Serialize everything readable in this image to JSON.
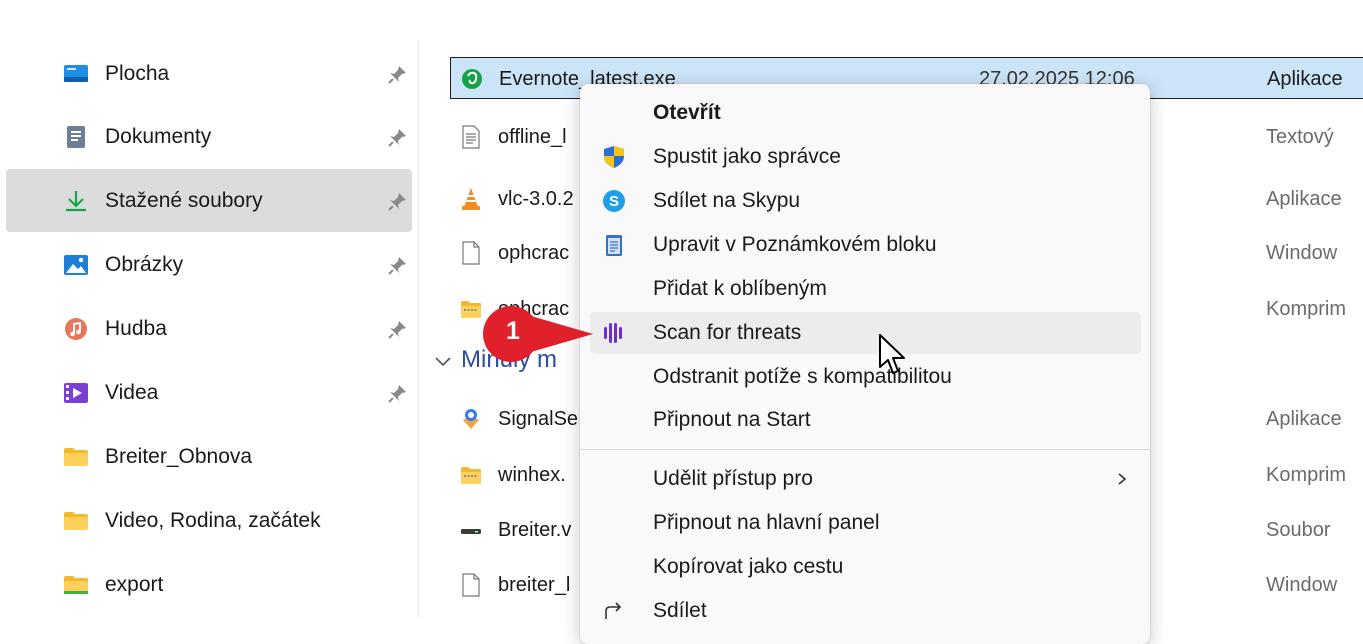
{
  "sidebar": {
    "items": [
      {
        "label": "Plocha",
        "icon": "desktop-icon",
        "pinned": true
      },
      {
        "label": "Dokumenty",
        "icon": "documents-icon",
        "pinned": true
      },
      {
        "label": "Stažené soubory",
        "icon": "download-icon",
        "pinned": true,
        "selected": true
      },
      {
        "label": "Obrázky",
        "icon": "pictures-icon",
        "pinned": true
      },
      {
        "label": "Hudba",
        "icon": "music-icon",
        "pinned": true
      },
      {
        "label": "Videa",
        "icon": "videos-icon",
        "pinned": true
      },
      {
        "label": "Breiter_Obnova",
        "icon": "folder-icon",
        "pinned": false
      },
      {
        "label": "Video, Rodina, začátek",
        "icon": "folder-icon",
        "pinned": false
      },
      {
        "label": "export",
        "icon": "folder-icon",
        "pinned": false
      }
    ]
  },
  "files": {
    "rows": [
      {
        "name": "Evernote_latest.exe",
        "date": "27.02.2025 12:06",
        "type": "Aplikace",
        "icon": "evernote-icon",
        "selected": true
      },
      {
        "name": "offline_l",
        "date": "",
        "type": "Textový",
        "icon": "text-file-icon"
      },
      {
        "name": "vlc-3.0.2",
        "date": "",
        "type": "Aplikace",
        "icon": "vlc-icon"
      },
      {
        "name": "ophcrac",
        "date": "",
        "type": "Window",
        "icon": "blank-file-icon"
      },
      {
        "name": "ophcrac",
        "date": "",
        "type": "Komprim",
        "icon": "zip-folder-icon"
      },
      {
        "name": "SignalSe",
        "date": "",
        "type": "Aplikace",
        "icon": "signal-setup-icon"
      },
      {
        "name": "winhex.",
        "date": "",
        "type": "Komprim",
        "icon": "zip-folder-icon"
      },
      {
        "name": "Breiter.v",
        "date": "",
        "type": "Soubor",
        "icon": "drive-file-icon"
      },
      {
        "name": "breiter_l",
        "date": "",
        "type": "Window",
        "icon": "blank-file-icon"
      }
    ],
    "group_header": "Minulý m"
  },
  "context_menu": {
    "items": [
      {
        "label": "Otevřít",
        "icon": "",
        "bold": true
      },
      {
        "label": "Spustit jako správce",
        "icon": "uac-shield-icon"
      },
      {
        "label": "Sdílet na Skypu",
        "icon": "skype-icon"
      },
      {
        "label": "Upravit v Poznámkovém bloku",
        "icon": "notepad-icon"
      },
      {
        "label": "Přidat k oblíbeným",
        "icon": ""
      },
      {
        "label": "Scan for threats",
        "icon": "scan-threats-icon",
        "hover": true
      },
      {
        "label": "Odstranit potíže s kompatibilitou",
        "icon": ""
      },
      {
        "label": "Připnout na Start",
        "icon": ""
      },
      {
        "label": "Udělit přístup pro",
        "icon": "",
        "submenu": true
      },
      {
        "label": "Připnout na hlavní panel",
        "icon": ""
      },
      {
        "label": "Kopírovat jako cestu",
        "icon": ""
      },
      {
        "label": "Sdílet",
        "icon": "share-icon"
      }
    ]
  },
  "annotation": {
    "step": "1",
    "color": "#e0202a"
  },
  "colors": {
    "selection": "#cce4f7",
    "sidebar_selected": "#dcdcdc",
    "group_header": "#2b4ea2",
    "menu_hover": "#ececec"
  }
}
